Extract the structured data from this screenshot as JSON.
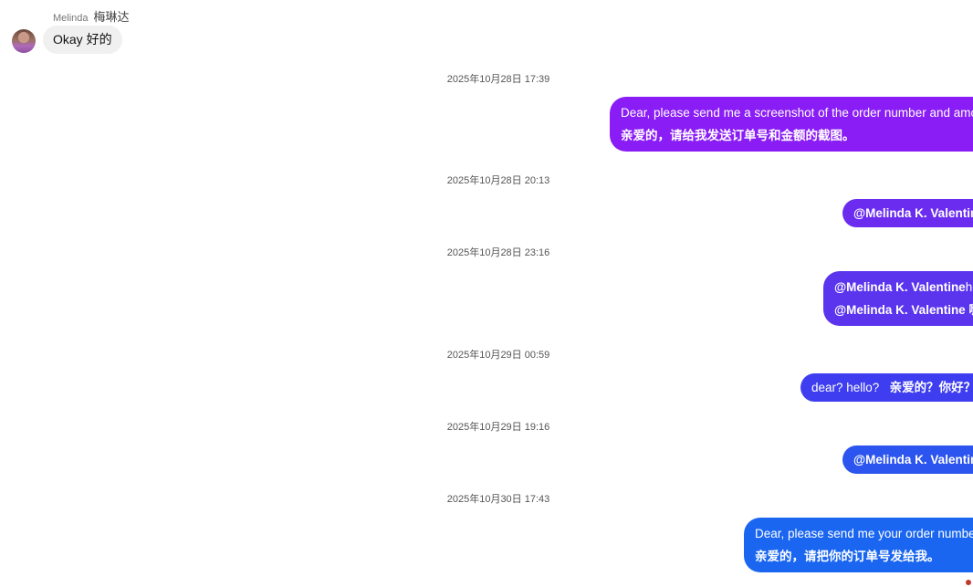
{
  "incoming": {
    "sender_name_en": "Melinda",
    "sender_name_zh": "梅琳达",
    "message": "Okay  好的"
  },
  "colors": {
    "bubble_1": "#8a1cf5",
    "bubble_2": "#6b2cf0",
    "bubble_3": "#5b34ee",
    "bubble_4": "#3e3ef0",
    "bubble_5": "#2c55ef",
    "bubble_6": "#1a66f0",
    "incoming_bubble": "#f0f0f0"
  },
  "messages": [
    {
      "timestamp": "2025年10月28日 17:39",
      "line1": "Dear, please send me a screenshot of the order number and amount.",
      "line2": "亲爱的，请给我发送订单号和金额的截图。"
    },
    {
      "timestamp": "2025年10月28日 20:13",
      "line1": "@Melinda K. Valentine"
    },
    {
      "timestamp": "2025年10月28日 23:16",
      "line1_mention": "@Melinda K. Valentine",
      "line1_rest": "hello?",
      "line2": "@Melinda K. Valentine 嗨？"
    },
    {
      "timestamp": "2025年10月29日 00:59",
      "line1_en": "dear?  hello?",
      "line1_zh": "亲爱的？你好？"
    },
    {
      "timestamp": "2025年10月29日 19:16",
      "line1": "@Melinda K. Valentine"
    },
    {
      "timestamp": "2025年10月30日 17:43",
      "line1": "Dear, please send me your order number.",
      "line2": "亲爱的，请把你的订单号发给我。"
    }
  ]
}
